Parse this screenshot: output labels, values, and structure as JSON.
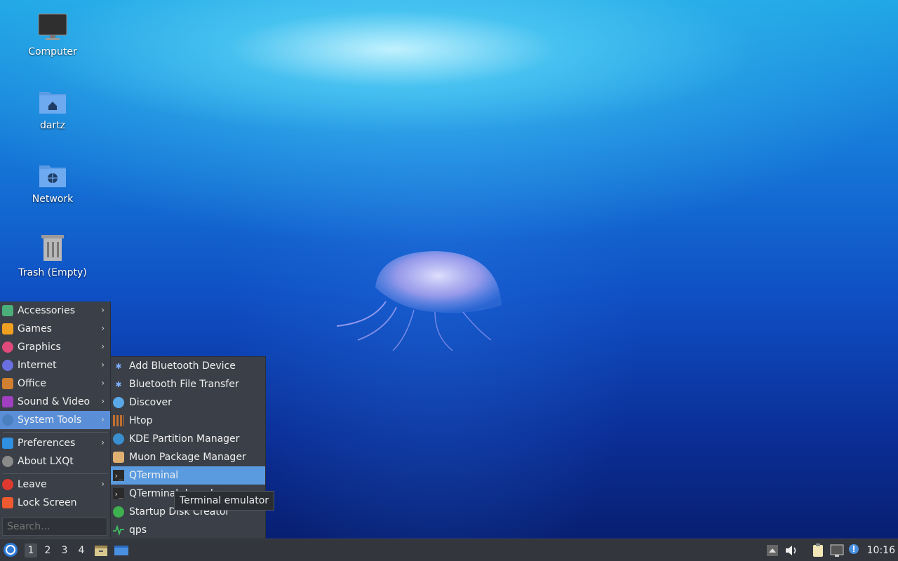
{
  "desktop": {
    "icons": [
      {
        "label": "Computer",
        "icon": "monitor-icon"
      },
      {
        "label": "dartz",
        "icon": "home-folder-icon"
      },
      {
        "label": "Network",
        "icon": "network-folder-icon"
      },
      {
        "label": "Trash (Empty)",
        "icon": "trash-icon"
      }
    ]
  },
  "menu": {
    "items": [
      {
        "label": "Accessories",
        "icon": "accessories-icon",
        "color": "#4caf7a",
        "submenu": true
      },
      {
        "label": "Games",
        "icon": "games-icon",
        "color": "#f0a020",
        "submenu": true
      },
      {
        "label": "Graphics",
        "icon": "graphics-icon",
        "color": "#e04a7a",
        "submenu": true
      },
      {
        "label": "Internet",
        "icon": "internet-icon",
        "color": "#6a70e0",
        "submenu": true
      },
      {
        "label": "Office",
        "icon": "office-icon",
        "color": "#d08030",
        "submenu": true
      },
      {
        "label": "Sound & Video",
        "icon": "sound-video-icon",
        "color": "#a040c0",
        "submenu": true
      },
      {
        "label": "System Tools",
        "icon": "system-tools-icon",
        "color": "#4a7fc0",
        "submenu": true,
        "active": true
      },
      {
        "label": "Preferences",
        "icon": "preferences-icon",
        "color": "#2f8fe0",
        "submenu": true
      },
      {
        "label": "About LXQt",
        "icon": "about-icon",
        "color": "#8a8a8a",
        "submenu": false
      },
      {
        "label": "Leave",
        "icon": "leave-icon",
        "color": "#e03a30",
        "submenu": true
      },
      {
        "label": "Lock Screen",
        "icon": "lock-icon",
        "color": "#f05a30",
        "submenu": false
      }
    ],
    "search_placeholder": "Search..."
  },
  "submenu": {
    "items": [
      {
        "label": "Add Bluetooth Device",
        "icon": "bluetooth-icon"
      },
      {
        "label": "Bluetooth File Transfer",
        "icon": "bluetooth-icon"
      },
      {
        "label": "Discover",
        "icon": "discover-icon"
      },
      {
        "label": "Htop",
        "icon": "htop-icon"
      },
      {
        "label": "KDE Partition Manager",
        "icon": "partition-manager-icon"
      },
      {
        "label": "Muon Package Manager",
        "icon": "package-manager-icon"
      },
      {
        "label": "QTerminal",
        "icon": "terminal-icon",
        "highlight": true
      },
      {
        "label": "QTerminal drop down",
        "icon": "terminal-icon"
      },
      {
        "label": "Startup Disk Creator",
        "icon": "startup-disk-icon"
      },
      {
        "label": "qps",
        "icon": "qps-icon"
      }
    ],
    "tooltip": "Terminal emulator"
  },
  "taskbar": {
    "workspaces": [
      "1",
      "2",
      "3",
      "4"
    ],
    "active_workspace": "1",
    "clock": "10:16"
  },
  "colors": {
    "menu_bg": "#3b3f47",
    "highlight": "#5a9be0",
    "taskbar_bg": "#33363c"
  }
}
